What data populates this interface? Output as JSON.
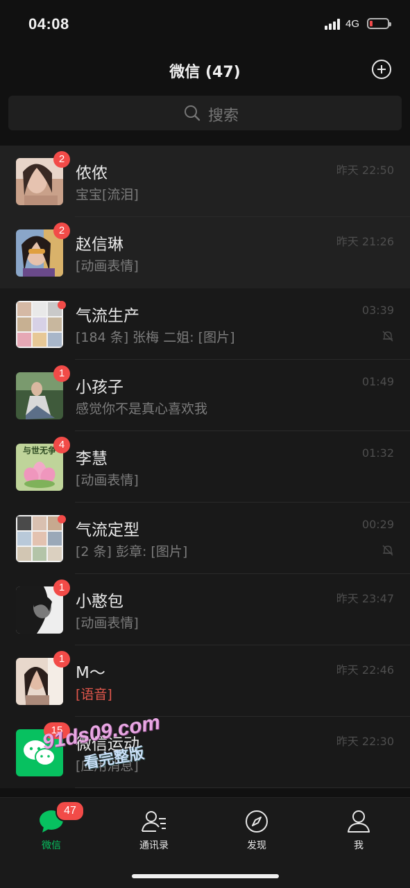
{
  "status_bar": {
    "time": "04:08",
    "network": "4G"
  },
  "header": {
    "title": "微信 (47)"
  },
  "search": {
    "placeholder": "搜索"
  },
  "chats": [
    {
      "name": "侬侬",
      "preview": "宝宝[流泪]",
      "time": "昨天 22:50",
      "badge": "2",
      "pinned": true
    },
    {
      "name": "赵信琳",
      "preview": "[动画表情]",
      "time": "昨天 21:26",
      "badge": "2",
      "pinned": true
    },
    {
      "name": "气流生产",
      "preview": "[184 条] 张梅 二姐: [图片]",
      "time": "03:39",
      "dot": true,
      "muted": true
    },
    {
      "name": "小孩子",
      "preview": "感觉你不是真心喜欢我",
      "time": "01:49",
      "badge": "1"
    },
    {
      "name": "李慧",
      "preview": "[动画表情]",
      "time": "01:32",
      "badge": "4",
      "avatar_text": "与世无争"
    },
    {
      "name": "气流定型",
      "preview": "[2 条] 彭章: [图片]",
      "time": "00:29",
      "dot": true,
      "muted": true
    },
    {
      "name": "小憨包",
      "preview": "[动画表情]",
      "time": "昨天 23:47",
      "badge": "1"
    },
    {
      "name": "M～",
      "preview": "[语音]",
      "time": "昨天 22:46",
      "badge": "1",
      "preview_color": "red"
    },
    {
      "name": "微信运动",
      "preview": "[应用消息]",
      "time": "昨天 22:30",
      "badge": "15"
    }
  ],
  "watermark": {
    "line1": "91ds09.com",
    "line2": "看完整版"
  },
  "tab_bar": {
    "tabs": [
      {
        "label": "微信",
        "icon": "chat-bubble-icon",
        "badge": "47",
        "active": true
      },
      {
        "label": "通讯录",
        "icon": "contacts-icon"
      },
      {
        "label": "发现",
        "icon": "compass-icon"
      },
      {
        "label": "我",
        "icon": "person-icon"
      }
    ]
  },
  "colors": {
    "accent": "#07c160",
    "badge": "#f24b48",
    "background": "#111111"
  }
}
